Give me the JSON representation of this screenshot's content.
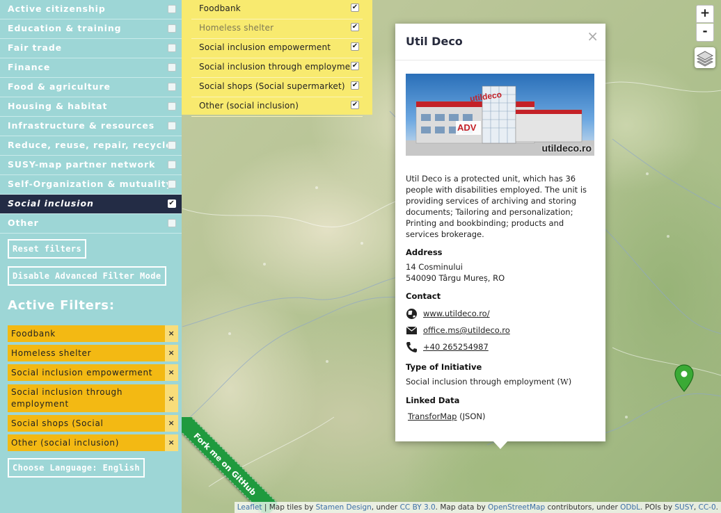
{
  "sidebar": {
    "categories": [
      {
        "label": "Active citizenship",
        "checked": false
      },
      {
        "label": "Education & training",
        "checked": false
      },
      {
        "label": "Fair trade",
        "checked": false
      },
      {
        "label": "Finance",
        "checked": false
      },
      {
        "label": "Food & agriculture",
        "checked": false
      },
      {
        "label": "Housing & habitat",
        "checked": false
      },
      {
        "label": "Infrastructure & resources",
        "checked": false
      },
      {
        "label": "Reduce, reuse, repair, recycle",
        "checked": false
      },
      {
        "label": "SUSY-map partner network",
        "checked": false
      },
      {
        "label": "Self-Organization & mutuality",
        "checked": false
      },
      {
        "label": "Social inclusion",
        "checked": true
      },
      {
        "label": "Other",
        "checked": false
      }
    ],
    "reset_label": "Reset filters",
    "advanced_label": "Disable Advanced Filter Mode",
    "active_title": "Active Filters:",
    "active_filters": [
      {
        "label": "Foodbank",
        "remove": "×"
      },
      {
        "label": "Homeless shelter",
        "remove": "×"
      },
      {
        "label": "Social inclusion empowerment",
        "remove": "×"
      },
      {
        "label": "Social inclusion through employment",
        "remove": "×"
      },
      {
        "label": "Social shops (Social supermarket)",
        "remove": "×"
      },
      {
        "label": "Other (social inclusion)",
        "remove": "×"
      }
    ],
    "language_label": "Choose Language: English"
  },
  "subfilters": [
    {
      "label": "Foodbank",
      "checked": true
    },
    {
      "label": "Homeless shelter",
      "checked": true
    },
    {
      "label": "Social inclusion empowerment",
      "checked": true
    },
    {
      "label": "Social inclusion through employment",
      "checked": true
    },
    {
      "label": "Social shops (Social supermarket)",
      "checked": true
    },
    {
      "label": "Other (social inclusion)",
      "checked": true
    }
  ],
  "popup": {
    "title": "Util Deco",
    "close": "×",
    "photo_sign": "utildeco",
    "photo_sign2": "utildeco.ro",
    "photo_logo": "ADV",
    "description": "Util Deco is a protected unit, which has 36 people with disabilities employed. The unit is providing services of archiving and storing documents; Tailoring and personalization; Printing and bookbinding; products and services brokerage.",
    "address_heading": "Address",
    "address_line1": "14 Cosminului",
    "address_line2": "540090 Târgu Mureș, RO",
    "contact_heading": "Contact",
    "website": "www.utildeco.ro/",
    "email": "office.ms@utildeco.ro",
    "phone": "+40 265254987",
    "type_heading": "Type of Initiative",
    "type_value": "Social inclusion through employment (",
    "type_wiki": "W",
    "type_close": ")",
    "linked_heading": "Linked Data",
    "linked_link": "TransforMap",
    "linked_suffix": " (JSON)"
  },
  "controls": {
    "zoom_in": "+",
    "zoom_out": "-"
  },
  "ribbon_text": "Fork me on GitHub",
  "attribution": {
    "leaflet": "Leaflet",
    "t1": " | Map tiles by ",
    "stamen": "Stamen Design",
    "t2": ", under ",
    "ccby": "CC BY 3.0",
    "t3": ". Map data by ",
    "osm": "OpenStreetMap",
    "t4": " contributors, under ",
    "odbl": "ODbL",
    "t5": ". POIs by ",
    "susy": "SUSY",
    "t6": ", ",
    "cc0": "CC-0",
    "t7": "."
  },
  "colors": {
    "sidebar": "#9dd6d6",
    "active_category": "#232c45",
    "subpanel": "#f8ea6f",
    "filter_tag": "#f3b913",
    "marker": "#3aaa35",
    "ribbon": "#1f9a3e"
  }
}
